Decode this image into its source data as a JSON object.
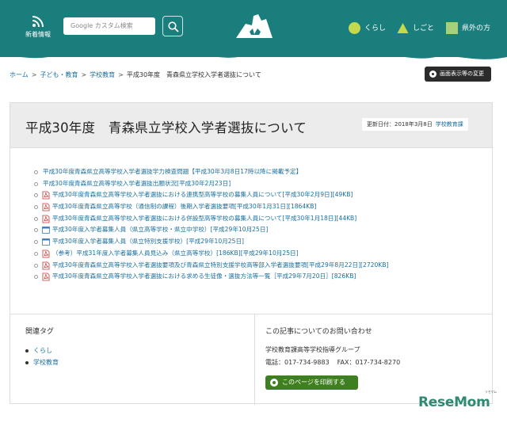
{
  "header": {
    "news_label": "新着情報",
    "search_placeholder": "Google カスタム検索",
    "nav": [
      {
        "label": "くらし",
        "shape": "circle",
        "color": "#c4d94d"
      },
      {
        "label": "しごと",
        "shape": "triangle",
        "color": "#c4d94d"
      },
      {
        "label": "県外の方",
        "shape": "square",
        "color": "#a8d07a"
      }
    ],
    "colors": {
      "primary": "#1a7e7c",
      "wave": "#e8f2f2"
    }
  },
  "breadcrumb": [
    {
      "label": "ホーム",
      "link": true
    },
    {
      "label": "子ども・教育",
      "link": true
    },
    {
      "label": "学校教育",
      "link": true
    },
    {
      "label": "平成30年度　青森県立学校入学者選抜について",
      "link": false
    }
  ],
  "view_button": "画面表示等の変更",
  "page": {
    "title": "平成30年度　青森県立学校入学者選抜について",
    "updated": "更新日付：2018年3月8日",
    "department": "学校教育課"
  },
  "documents": [
    {
      "text": "平成30年度青森県立高等学校入学者選抜学力検査問題【平成30年3月8日17時以降に掲載予定】",
      "icon": "none"
    },
    {
      "text": "平成30年度青森県立高等学校入学者選抜出願状況[平成30年2月23日]",
      "icon": "none"
    },
    {
      "text": "平成30年度青森県立高等学校入学者選抜における連携型高等学校の募集人員について[平成30年2月9日][49KB]",
      "icon": "pdf-icon"
    },
    {
      "text": "平成30年度青森県立高等学校（通信制の課程）後期入学者選抜要項[平成30年1月31日][1864KB]",
      "icon": "pdf-icon"
    },
    {
      "text": "平成30年度青森県立高等学校入学者選抜における併設型高等学校の募集人員について[平成30年1月18日][44KB]",
      "icon": "pdf-icon"
    },
    {
      "text": "平成30年度入学者募集人員（県立高等学校・県立中学校）[平成29年10月25日]",
      "icon": "page-icon"
    },
    {
      "text": "平成30年度入学者募集人員（県立特別支援学校）[平成29年10月25日]",
      "icon": "page-icon"
    },
    {
      "text": "（参考）平成31年度入学者募集人員見込み（県立高等学校）[186KB][平成29年10月25日]",
      "icon": "pdf-icon"
    },
    {
      "text": "平成30年度青森県立高等学校入学者選抜要項及び青森県立特別支援学校高等部入学者選抜要項[平成29年8月22日][2720KB]",
      "icon": "pdf-icon"
    },
    {
      "text": "平成30年度青森県立高等学校入学者選抜における求める生徒像・選抜方法等一覧［平成29年7月20日］[826KB]",
      "icon": "pdf-icon"
    }
  ],
  "tags": {
    "title": "関連タグ",
    "items": [
      "くらし",
      "学校教育"
    ]
  },
  "contact": {
    "title": "この記事についてのお問い合わせ",
    "dept": "学校教育課高等学校指導グループ",
    "tel": "電話：017-734-9883",
    "fax": "FAX：017-734-8270",
    "print_label": "このページを印刷する",
    "print_color": "#3e7f1f"
  },
  "watermark": {
    "text": "ReseMom",
    "sub": "リセマム"
  }
}
